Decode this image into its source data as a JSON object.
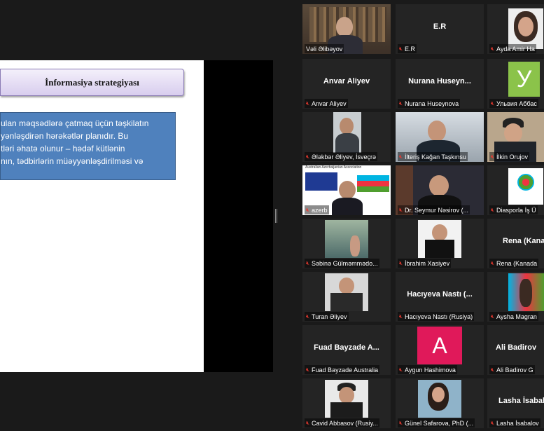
{
  "slide": {
    "title": "İnformasiya strategiyası",
    "body_lines": [
      "ulan məqsədlərə çatmaq üçün təşkilatın",
      "yənləşdirən hərəkətlər planıdır. Bu",
      "tləri əhatə olunur – hədəf kütlənin",
      "nın, tədbirlərin müəyyənləşdirilməsi və"
    ]
  },
  "participants": [
    {
      "label": "Vəli Əlibəyov",
      "display": "",
      "icon": "video"
    },
    {
      "label": "E.R",
      "display": "E.R",
      "icon": "mic-off-icon"
    },
    {
      "label": "Ayda Amir Ha",
      "display": "",
      "icon": "mic-off-icon"
    },
    {
      "label": "Anvar Aliyev",
      "display": "Anvar Aliyev",
      "icon": "mic-off-icon"
    },
    {
      "label": "Nurana Huseynova",
      "display": "Nurana  Huseyn...",
      "icon": "mic-off-icon"
    },
    {
      "label": "Ульвия Аббас",
      "display": "У",
      "icon": "mic-off-icon"
    },
    {
      "label": "Ələkbər Əliyev, İsveçrə",
      "display": "",
      "icon": "mic-off-icon"
    },
    {
      "label": "İlteriş Kağan Taşkınsu",
      "display": "",
      "icon": "mic-off-icon"
    },
    {
      "label": "İlkin Orujov",
      "display": "",
      "icon": "mic-off-icon"
    },
    {
      "label": "azerb",
      "display": "Australian Azerbaijanian Association",
      "icon": "mic-off-icon"
    },
    {
      "label": "Dr. Seymur Nəsirov (...",
      "display": "",
      "icon": "mic-off-icon"
    },
    {
      "label": "Diasporla İş Ü",
      "display": "",
      "icon": "mic-off-icon"
    },
    {
      "label": "Səbinə Gülməmmədo...",
      "display": "",
      "icon": "mic-off-icon"
    },
    {
      "label": "İbrahim Xasiyev",
      "display": "",
      "icon": "mic-off-icon"
    },
    {
      "label": "Rena (Kanada",
      "display": "Rena (Kana",
      "icon": "mic-off-icon"
    },
    {
      "label": "Turan Əliyev",
      "display": "",
      "icon": "mic-off-icon"
    },
    {
      "label": "Hacıyeva Nastı (Rusiya)",
      "display": "Hacıyeva Nastı (...",
      "icon": "mic-off-icon"
    },
    {
      "label": "Aysha Magran",
      "display": "",
      "icon": "mic-off-icon"
    },
    {
      "label": "Fuad Bayzade Australia",
      "display": "Fuad Bayzade A...",
      "icon": "mic-off-icon"
    },
    {
      "label": "Aygun Hashimova",
      "display": "A",
      "icon": "mic-off-icon"
    },
    {
      "label": "Ali Badirov  G",
      "display": "Ali Badirov",
      "icon": "mic-off-icon"
    },
    {
      "label": "Cavid Abbasov (Rusiy...",
      "display": "",
      "icon": "mic-off-icon"
    },
    {
      "label": "Günel Safarova, PhD (...",
      "display": "",
      "icon": "mic-off-icon"
    },
    {
      "label": "Lasha İsabalov",
      "display": "Lasha İsabal",
      "icon": "mic-off-icon"
    }
  ],
  "colors": {
    "active_speaker": "#c8f014",
    "mic_muted": "#e8392f",
    "slide_box": "#4f81bd",
    "avatar_green": "#8bc34a",
    "avatar_pink": "#e0195a"
  }
}
